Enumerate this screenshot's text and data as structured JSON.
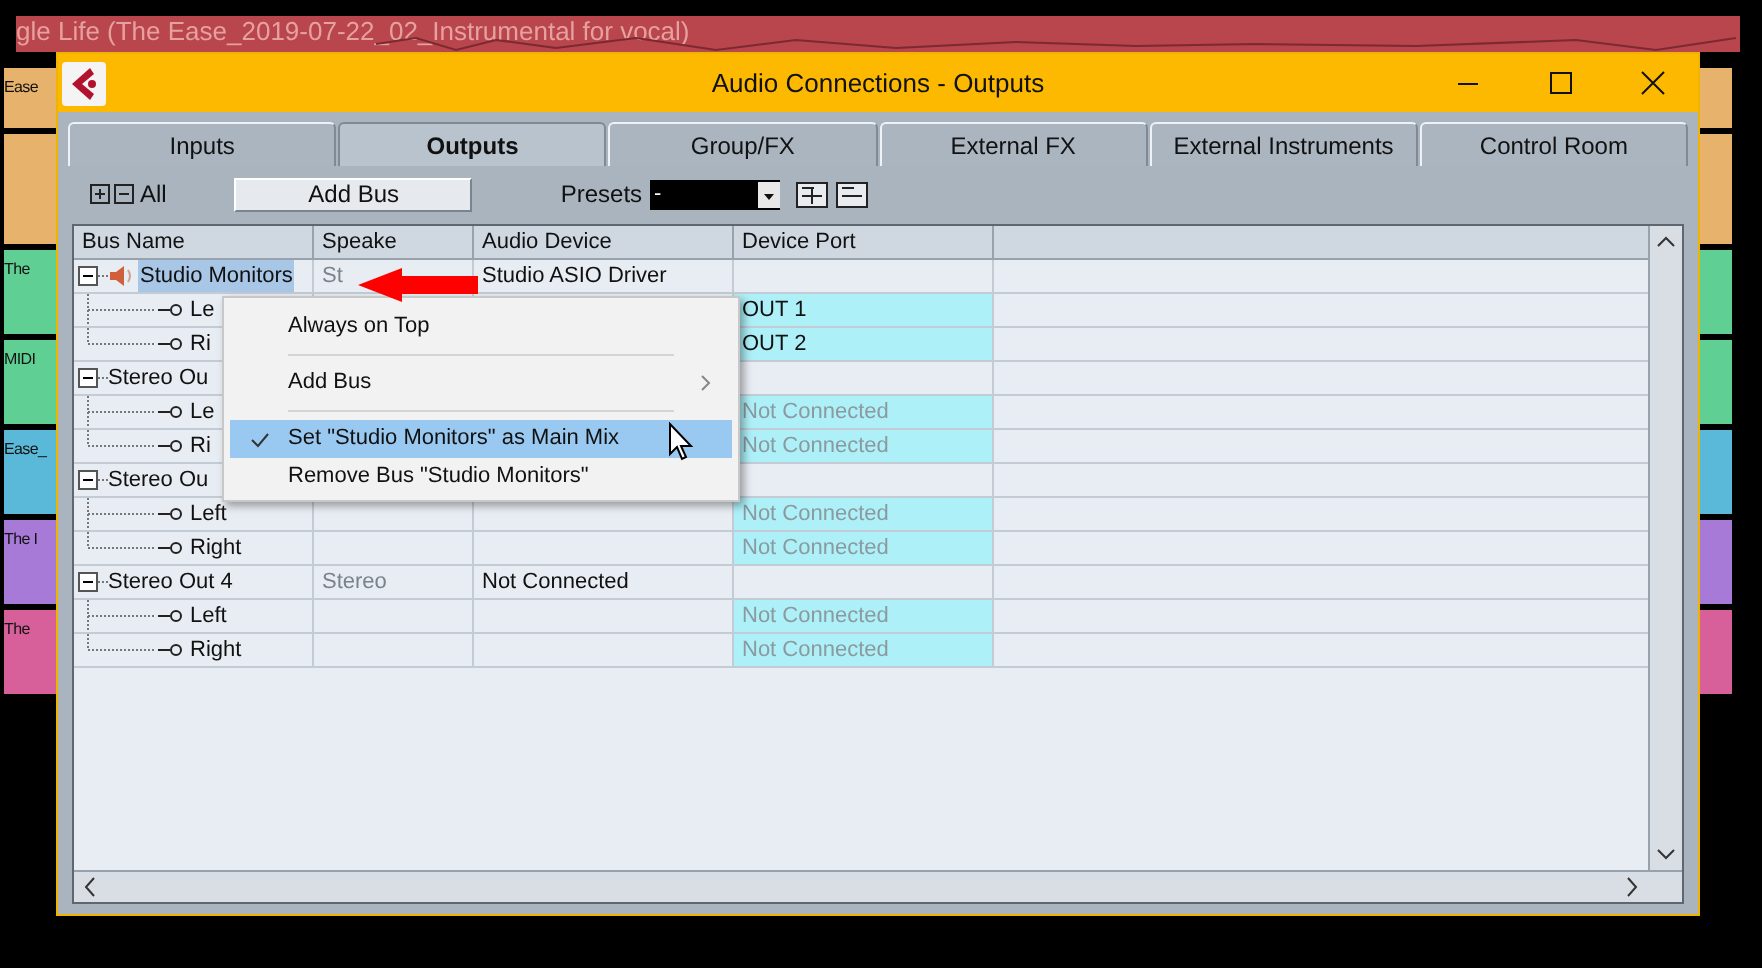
{
  "background": {
    "track_title": "gle Life (The Ease_2019-07-22_02_Instrumental for vocal)",
    "tracks": [
      {
        "label": "Ease",
        "color": "#e6b26c"
      },
      {
        "color": "#e6b26c"
      },
      {
        "label": "The",
        "color": "#5fcf94"
      },
      {
        "label": "MIDI",
        "color": "#5fcf94"
      },
      {
        "label": "Ease_",
        "color": "#5ab9d8"
      },
      {
        "label": "The I",
        "color": "#a77ad8"
      },
      {
        "label": "The",
        "color": "#d8609a"
      }
    ]
  },
  "window": {
    "title": "Audio Connections - Outputs",
    "tabs": [
      {
        "label": "Inputs",
        "selected": false
      },
      {
        "label": "Outputs",
        "selected": true
      },
      {
        "label": "Group/FX",
        "selected": false
      },
      {
        "label": "External FX",
        "selected": false
      },
      {
        "label": "External Instruments",
        "selected": false
      },
      {
        "label": "Control Room",
        "selected": false
      }
    ],
    "toolbar": {
      "all_label": "All",
      "add_bus": "Add Bus",
      "presets_label": "Presets",
      "preset_value": "-"
    },
    "table": {
      "columns": [
        "Bus Name",
        "Speake",
        "Audio Device",
        "Device Port"
      ],
      "buses": [
        {
          "name": "Studio Monitors",
          "selected": true,
          "speakers": "St",
          "device": "Studio ASIO Driver",
          "children": [
            {
              "name": "Le",
              "port": "OUT 1",
              "connected": true
            },
            {
              "name": "Ri",
              "port": "OUT 2",
              "connected": true
            }
          ]
        },
        {
          "name": "Stereo Ou",
          "selected": false,
          "children": [
            {
              "name": "Le",
              "port": "Not Connected",
              "connected": false
            },
            {
              "name": "Ri",
              "port": "Not Connected",
              "connected": false
            }
          ]
        },
        {
          "name": "Stereo Ou",
          "selected": false,
          "children": [
            {
              "name": "Left",
              "port": "Not Connected",
              "connected": false
            },
            {
              "name": "Right",
              "port": "Not Connected",
              "connected": false
            }
          ]
        },
        {
          "name": "Stereo Out 4",
          "selected": false,
          "speakers": "Stereo",
          "device": "Not Connected",
          "children": [
            {
              "name": "Left",
              "port": "Not Connected",
              "connected": false
            },
            {
              "name": "Right",
              "port": "Not Connected",
              "connected": false
            }
          ]
        }
      ]
    },
    "context_menu": {
      "items": [
        {
          "kind": "item",
          "label": "Always on Top",
          "checked": false,
          "selected": false
        },
        {
          "kind": "separator"
        },
        {
          "kind": "submenu",
          "label": "Add Bus",
          "checked": false,
          "selected": false
        },
        {
          "kind": "separator"
        },
        {
          "kind": "item",
          "label": "Set \"Studio Monitors\" as Main Mix",
          "checked": true,
          "selected": true
        },
        {
          "kind": "item",
          "label": "Remove Bus \"Studio Monitors\"",
          "checked": false,
          "selected": false
        }
      ]
    }
  }
}
